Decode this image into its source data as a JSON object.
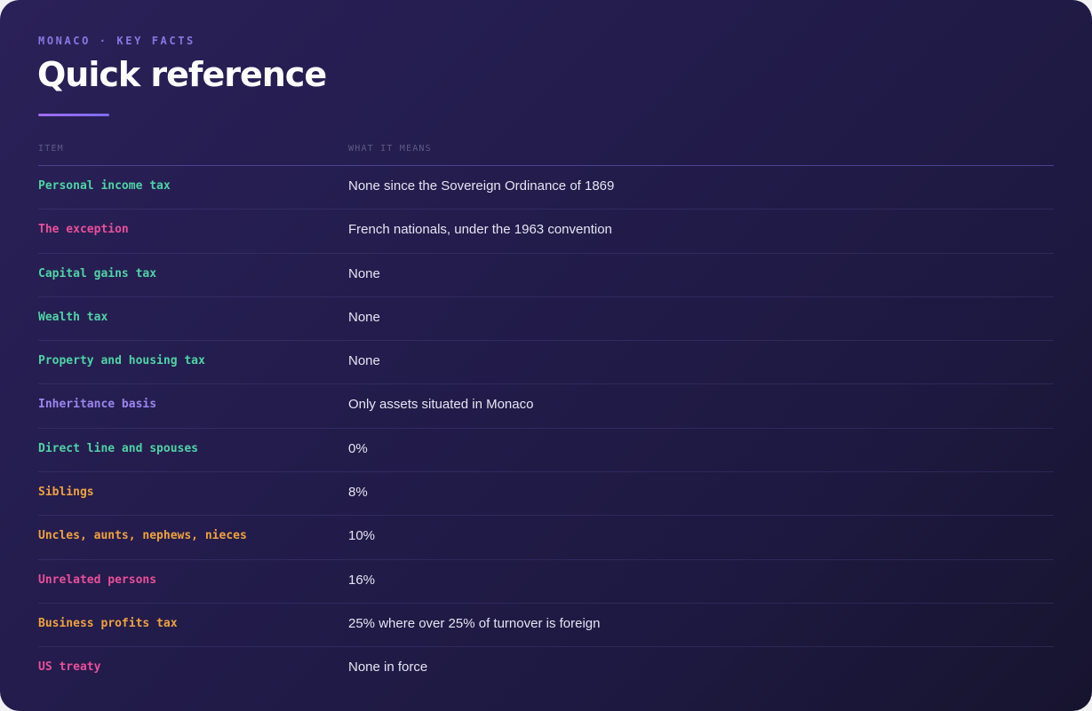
{
  "header": {
    "eyebrow": "MONACO · KEY FACTS",
    "title": "Quick reference"
  },
  "table": {
    "columns": [
      "ITEM",
      "WHAT IT MEANS"
    ],
    "rows": [
      {
        "item": "Personal income tax",
        "meaning": "None since the Sovereign Ordinance of 1869",
        "color": "#4fd3a5"
      },
      {
        "item": "The exception",
        "meaning": "French nationals, under the 1963 convention",
        "color": "#ea4f9a"
      },
      {
        "item": "Capital gains tax",
        "meaning": "None",
        "color": "#4fd3a5"
      },
      {
        "item": "Wealth tax",
        "meaning": "None",
        "color": "#4fd3a5"
      },
      {
        "item": "Property and housing tax",
        "meaning": "None",
        "color": "#4fd3a5"
      },
      {
        "item": "Inheritance basis",
        "meaning": "Only assets situated in Monaco",
        "color": "#9a86ef"
      },
      {
        "item": "Direct line and spouses",
        "meaning": "0%",
        "color": "#4fd3a5"
      },
      {
        "item": "Siblings",
        "meaning": "8%",
        "color": "#f0a23e"
      },
      {
        "item": "Uncles, aunts, nephews, nieces",
        "meaning": "10%",
        "color": "#f0a23e"
      },
      {
        "item": "Unrelated persons",
        "meaning": "16%",
        "color": "#ea4f9a"
      },
      {
        "item": "Business profits tax",
        "meaning": "25% where over 25% of turnover is foreign",
        "color": "#f0a23e"
      },
      {
        "item": "US treaty",
        "meaning": "None in force",
        "color": "#ea4f9a"
      }
    ]
  }
}
